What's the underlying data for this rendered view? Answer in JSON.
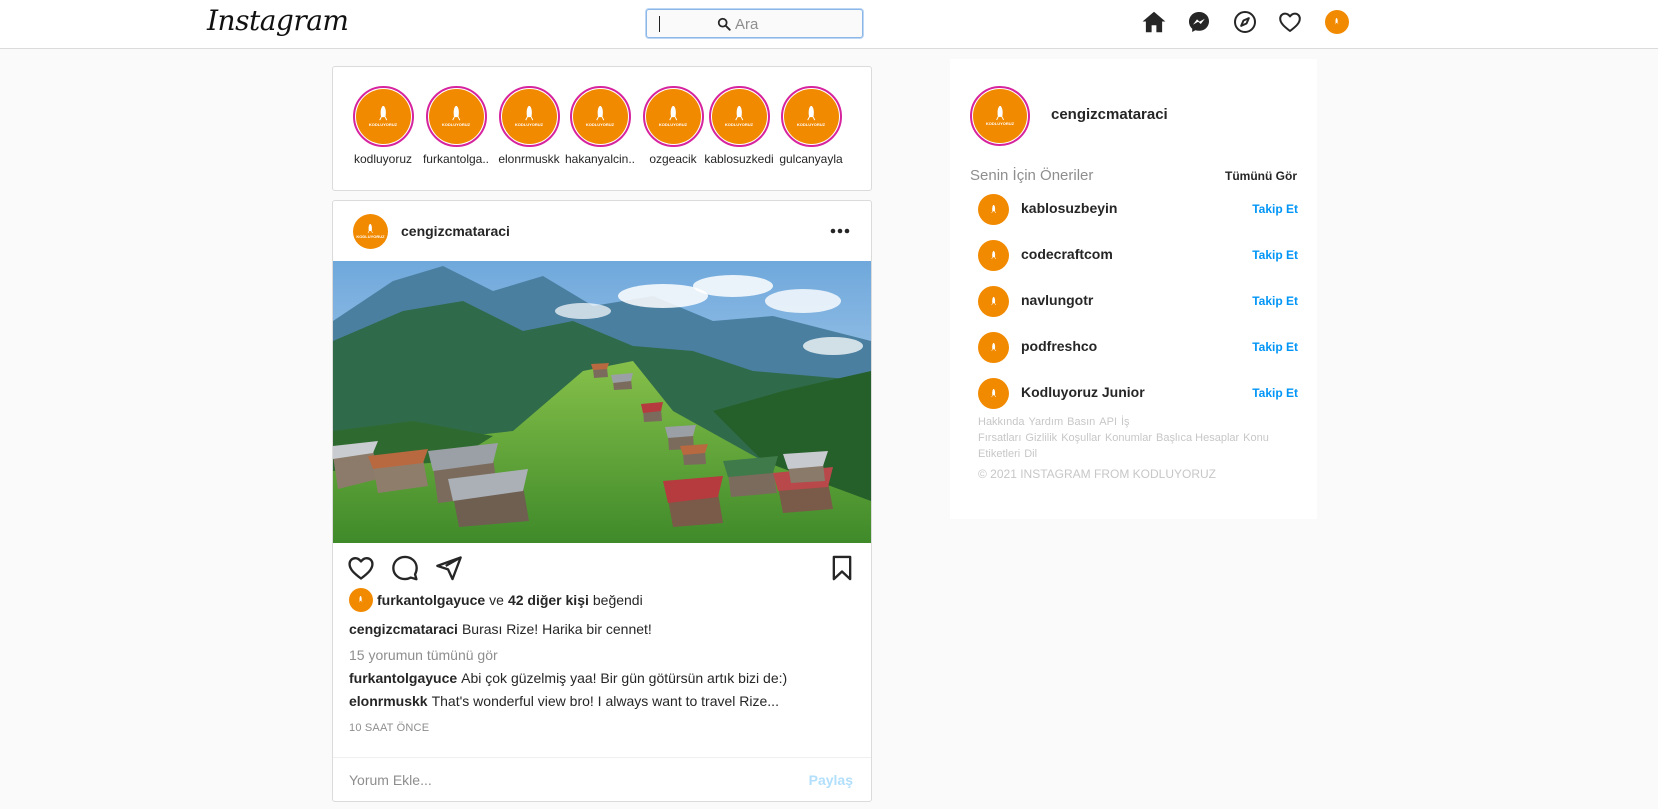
{
  "header": {
    "logo": "Instagram",
    "search_placeholder": "Ara"
  },
  "stories": [
    {
      "name": "kodluyoruz"
    },
    {
      "name": "furkantolga.."
    },
    {
      "name": "elonrmuskk"
    },
    {
      "name": "hakanyalcin.."
    },
    {
      "name": "ozgeacik"
    },
    {
      "name": "kablosuzkedi"
    },
    {
      "name": "gulcanyayla"
    }
  ],
  "avatar_text": "KODLUYORUZ",
  "post": {
    "username": "cengizcmataraci",
    "likes": {
      "user": "furkantolgayuce",
      "conj": "ve",
      "others": "42 diğer kişi",
      "suffix": "beğendi"
    },
    "caption": {
      "user": "cengizcmataraci",
      "text": "Burası Rize! Harika bir cennet!"
    },
    "view_all": "15 yorumun tümünü gör",
    "comments": [
      {
        "user": "furkantolgayuce",
        "text": "Abi çok güzelmiş yaa! Bir gün götürsün artık bizi de:)"
      },
      {
        "user": "elonrmuskk",
        "text": "That's wonderful view bro! I always want to travel Rize..."
      }
    ],
    "time": "10 SAAT ÖNCE",
    "comment_placeholder": "Yorum Ekle...",
    "share_label": "Paylaş"
  },
  "sidebar": {
    "username": "cengizcmataraci",
    "suggestions_title": "Senin İçin Öneriler",
    "see_all": "Tümünü Gör",
    "suggestions": [
      {
        "name": "kablosuzbeyin",
        "action": "Takip Et"
      },
      {
        "name": "codecraftcom",
        "action": "Takip Et"
      },
      {
        "name": "navlungotr",
        "action": "Takip Et"
      },
      {
        "name": "podfreshco",
        "action": "Takip Et"
      },
      {
        "name": "Kodluyoruz Junior",
        "action": "Takip Et"
      }
    ],
    "footer_links": [
      "Hakkında",
      "Yardım",
      "Basın",
      "API",
      "İş Fırsatları",
      "Gizlilik",
      "Koşullar",
      "Konumlar",
      "Başlıca Hesaplar",
      "Konu Etiketleri",
      "Dil"
    ],
    "copyright": "© 2021 INSTAGRAM FROM KODLUYORUZ"
  },
  "colors": {
    "accent": "#0095f6",
    "avatar_bg": "#f28a00",
    "story_ring": "#d6249f"
  },
  "icons": [
    "home-icon",
    "messenger-icon",
    "explore-icon",
    "heart-icon",
    "search-icon",
    "comment-icon",
    "send-icon",
    "bookmark-icon",
    "more-icon"
  ]
}
